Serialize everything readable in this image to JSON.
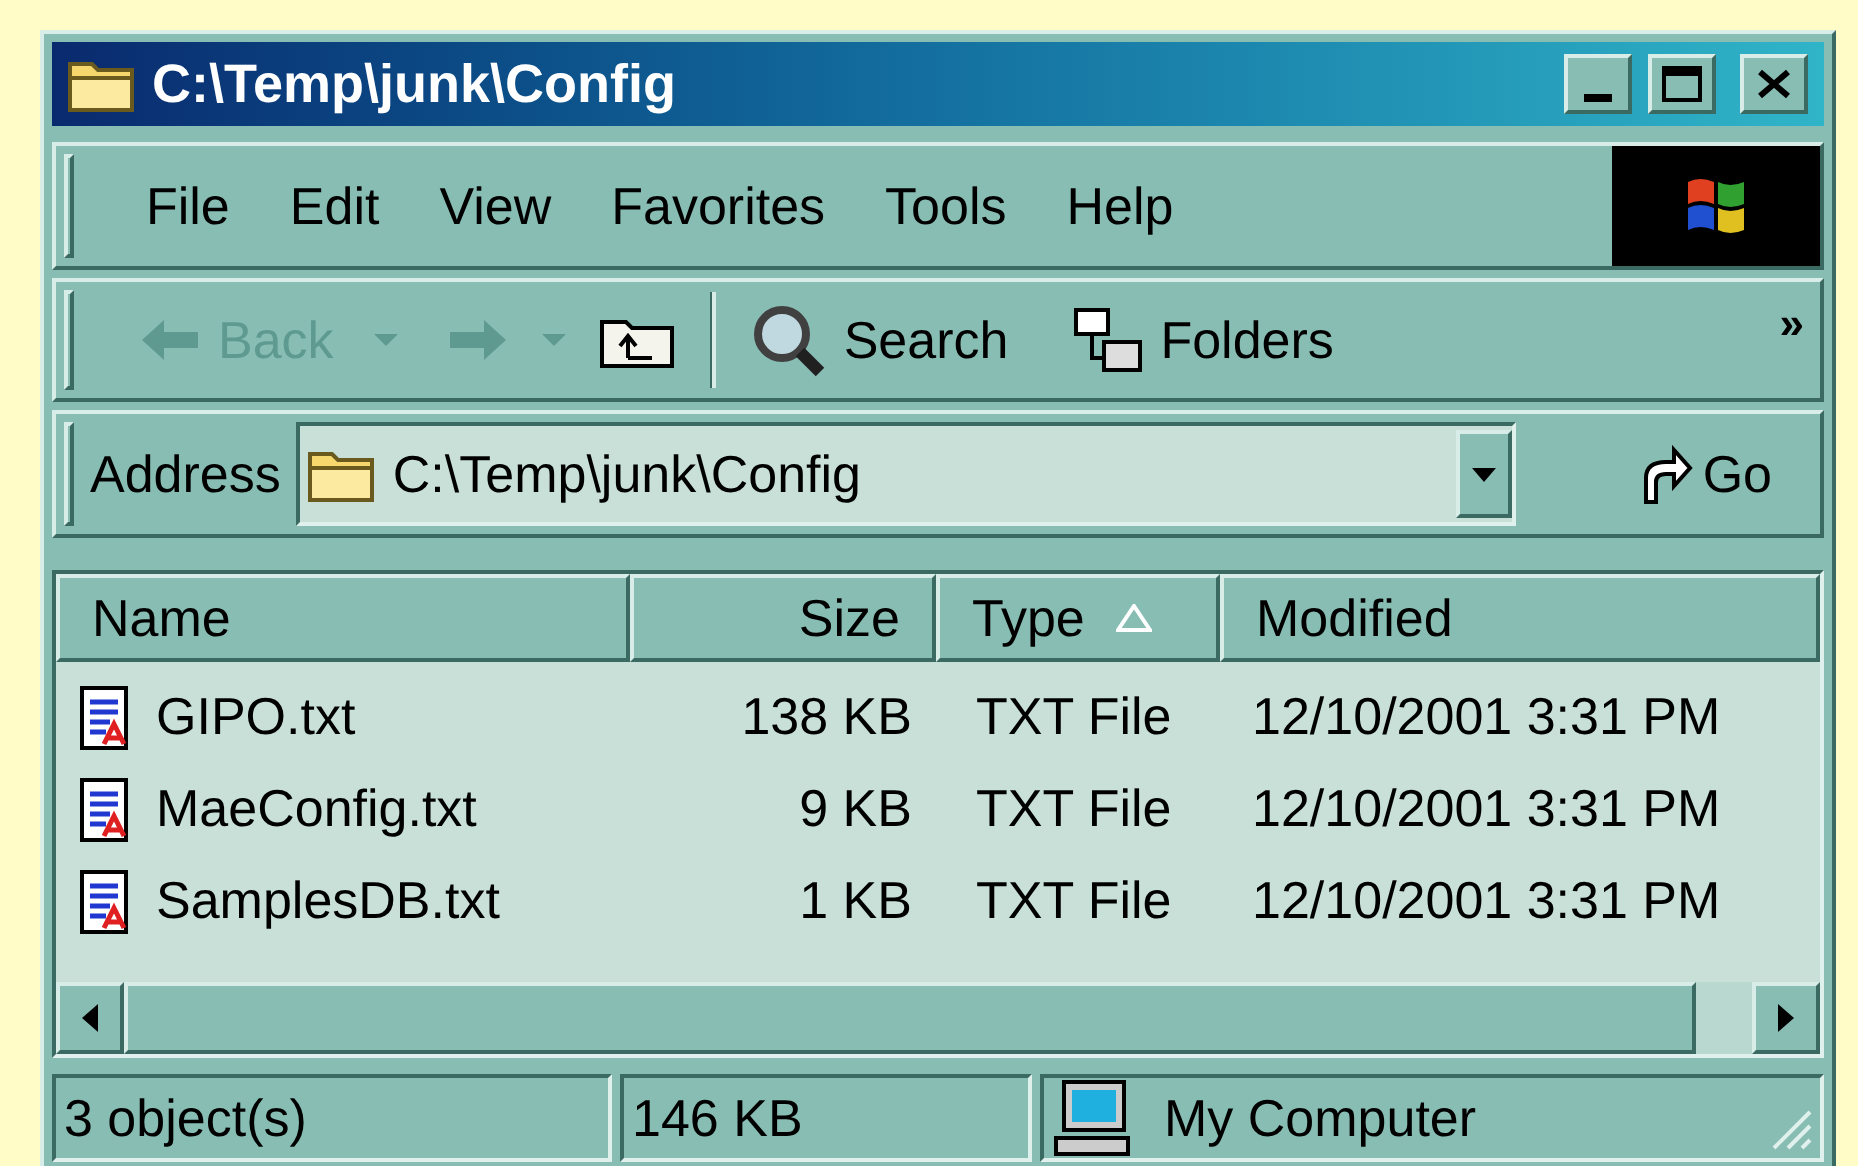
{
  "window": {
    "title": "C:\\Temp\\junk\\Config"
  },
  "menu": [
    {
      "label": "File"
    },
    {
      "label": "Edit"
    },
    {
      "label": "View"
    },
    {
      "label": "Favorites"
    },
    {
      "label": "Tools"
    },
    {
      "label": "Help"
    }
  ],
  "toolbar": {
    "back": {
      "label": "Back",
      "disabled": true
    },
    "forward": {
      "disabled": true
    },
    "search": {
      "label": "Search"
    },
    "folders": {
      "label": "Folders"
    },
    "more": "»"
  },
  "address": {
    "label": "Address",
    "value": "C:\\Temp\\junk\\Config",
    "go": "Go"
  },
  "columns": [
    {
      "label": "Name",
      "sorted": false
    },
    {
      "label": "Size",
      "sorted": false
    },
    {
      "label": "Type",
      "sorted": true
    },
    {
      "label": "Modified",
      "sorted": false
    }
  ],
  "rows": [
    {
      "name": "GIPO.txt",
      "size": "138 KB",
      "type": "TXT File",
      "modified": "12/10/2001 3:31 PM"
    },
    {
      "name": "MaeConfig.txt",
      "size": "9 KB",
      "type": "TXT File",
      "modified": "12/10/2001 3:31 PM"
    },
    {
      "name": "SamplesDB.txt",
      "size": "1 KB",
      "type": "TXT File",
      "modified": "12/10/2001 3:31 PM"
    }
  ],
  "status_bar": {
    "objects": "3 object(s)",
    "size": "146 KB",
    "zone": "My Computer"
  }
}
